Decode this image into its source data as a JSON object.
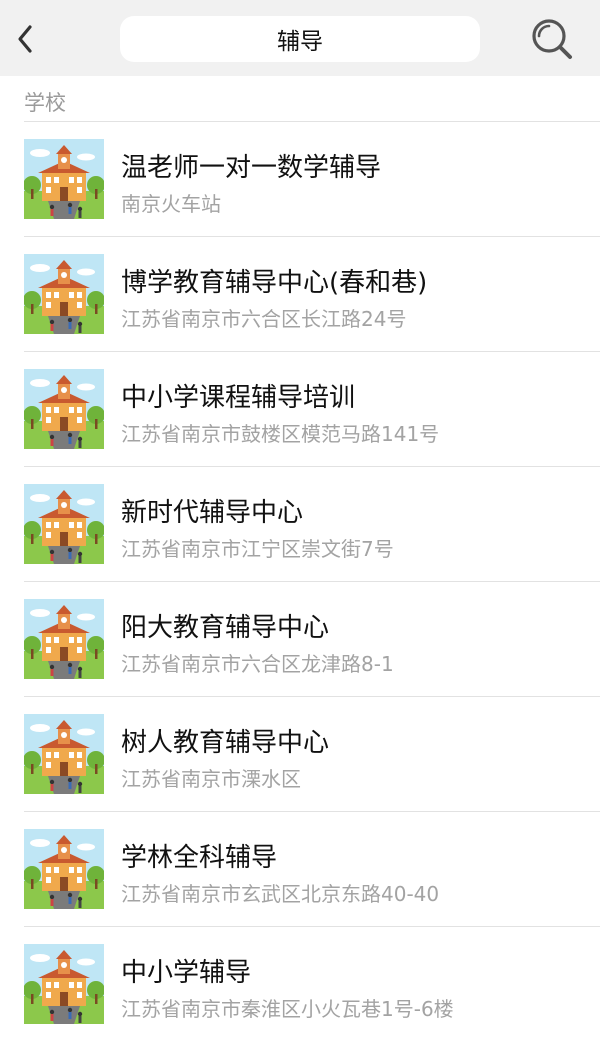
{
  "header": {
    "title": "辅导"
  },
  "section": {
    "title": "学校"
  },
  "items": [
    {
      "name": "温老师一对一数学辅导",
      "address": "南京火车站"
    },
    {
      "name": "博学教育辅导中心(春和巷)",
      "address": "江苏省南京市六合区长江路24号"
    },
    {
      "name": "中小学课程辅导培训",
      "address": "江苏省南京市鼓楼区模范马路141号"
    },
    {
      "name": "新时代辅导中心",
      "address": "江苏省南京市江宁区崇文街7号"
    },
    {
      "name": "阳大教育辅导中心",
      "address": "江苏省南京市六合区龙津路8-1"
    },
    {
      "name": "树人教育辅导中心",
      "address": "江苏省南京市溧水区"
    },
    {
      "name": "学林全科辅导",
      "address": "江苏省南京市玄武区北京东路40-40"
    },
    {
      "name": "中小学辅导",
      "address": "江苏省南京市秦淮区小火瓦巷1号-6楼"
    }
  ],
  "icons": {
    "back": "chevron-left-icon",
    "search": "search-icon",
    "thumbnail": "school-building-icon"
  }
}
